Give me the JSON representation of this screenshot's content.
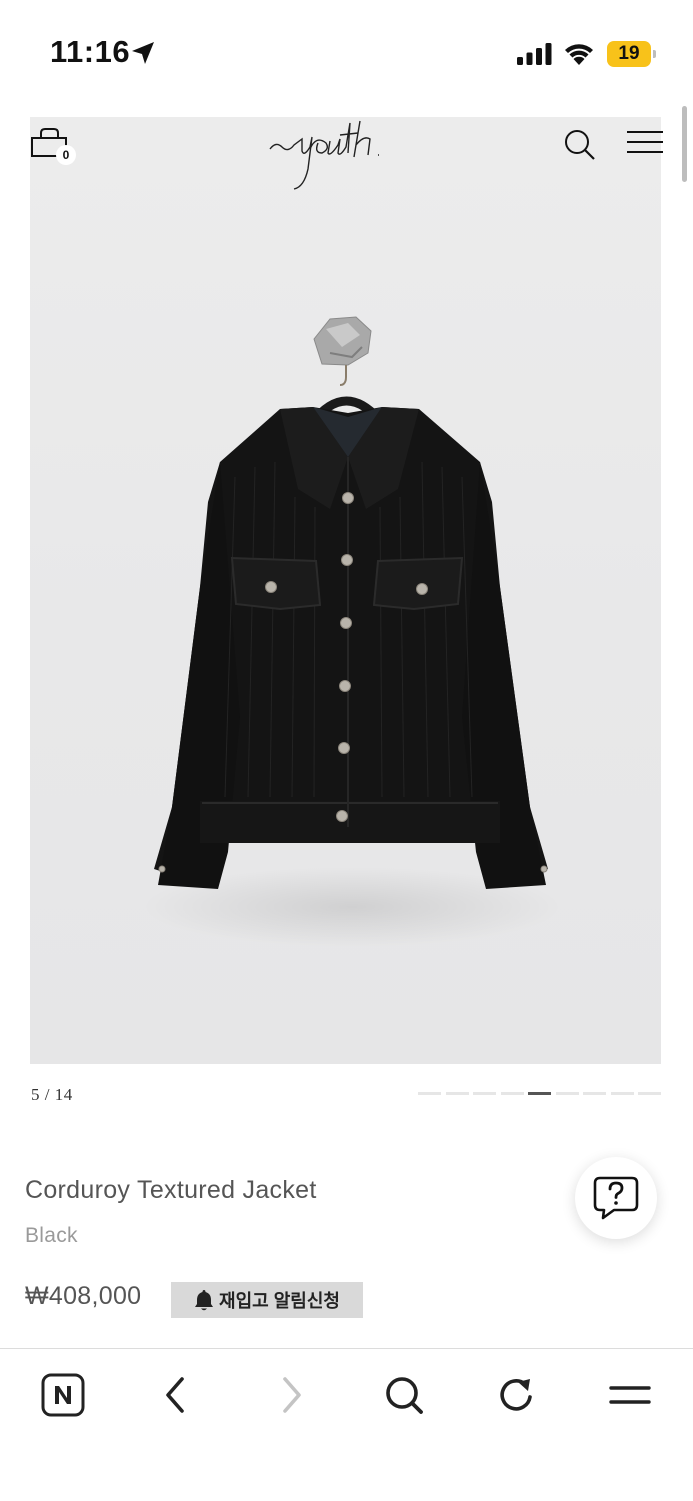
{
  "status_bar": {
    "time": "11:16",
    "battery": "19",
    "icons": [
      "location-arrow-icon",
      "cellular-signal-icon",
      "wifi-icon",
      "battery-icon"
    ]
  },
  "header": {
    "logo_text": "youth.",
    "cart_count": "0",
    "icons": [
      "cart-icon",
      "search-icon",
      "menu-icon"
    ]
  },
  "gallery": {
    "counter": "5 / 14",
    "total_slides": 9,
    "active_slide_index": 4
  },
  "product": {
    "name": "Corduroy Textured Jacket",
    "color": "Black",
    "price": "₩408,000",
    "restock_label": "재입고 알림신청"
  },
  "help": {
    "icon": "question-bubble-icon"
  },
  "browser_toolbar": {
    "items": [
      "naver-home-icon",
      "back-icon",
      "forward-icon",
      "search-icon",
      "reload-icon",
      "menu-icon"
    ],
    "forward_enabled": false
  },
  "colors": {
    "accent_battery": "#f8c21a",
    "image_background": "#e9e9ea",
    "restock_button": "#d9d9d9",
    "text_primary": "#555555",
    "text_secondary": "#9a9a9a"
  }
}
